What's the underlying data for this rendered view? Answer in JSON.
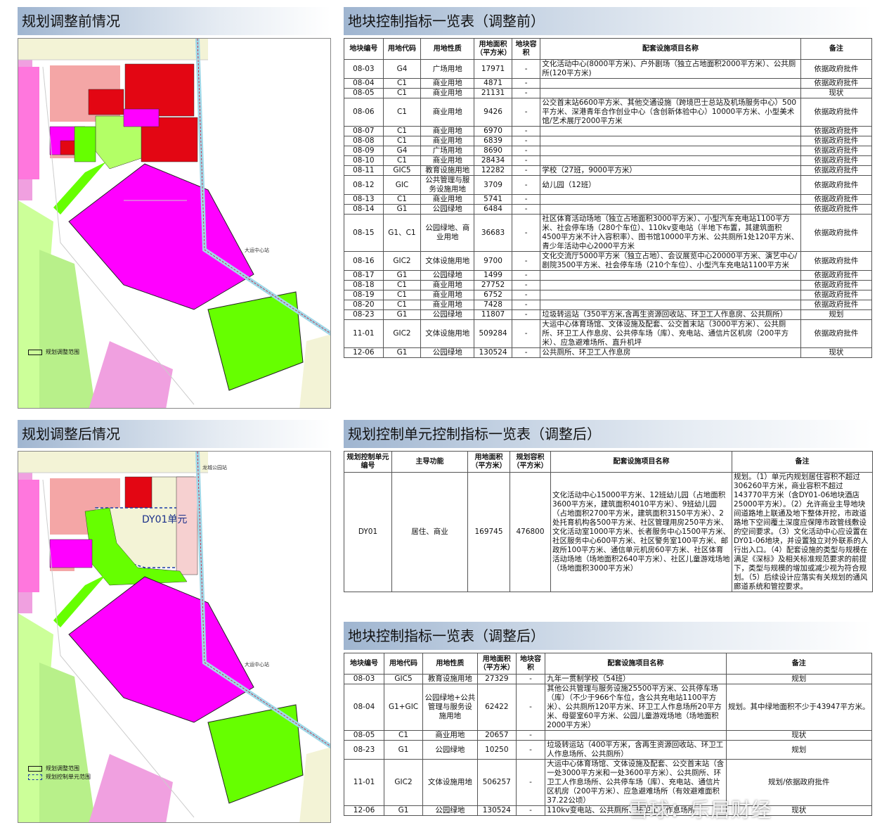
{
  "headers": {
    "before_map": "规划调整前情况",
    "after_map": "规划调整后情况",
    "before_table": "地块控制指标一览表（调整前）",
    "unit_table": "规划控制单元控制指标一览表（调整后）",
    "after_table": "地块控制指标一览表（调整后）"
  },
  "map_before": {
    "labels": {
      "metro": "大运中心站",
      "boundary": "规划调整范围"
    }
  },
  "map_after": {
    "labels": {
      "metro": "大运中心站",
      "park_station": "龙城公园站",
      "dy01": "DY01单元",
      "boundary": "规划调整范围",
      "unit_boundary": "规划控制单元范围"
    }
  },
  "colors": {
    "commercial": "#e30613",
    "public": "#ff00ff",
    "green": "#66ff00",
    "park": "#ccff99",
    "residential": "#f4a6a6",
    "pale": "#f3f3d6",
    "road": "#ffffff"
  },
  "table_before": {
    "columns": [
      "地块编号",
      "用地代码",
      "用地性质",
      "用地面积（平方米）",
      "地块容积",
      "配套设施项目名称",
      "备注"
    ],
    "rows": [
      [
        "08-03",
        "G4",
        "广场用地",
        "17971",
        "-",
        "文化活动中心(8000平方米)、户外剧场（独立占地面积2000平方米）、公共厕所(120平方米)",
        "依据政府批件"
      ],
      [
        "08-04",
        "C1",
        "商业用地",
        "4871",
        "-",
        "",
        "依据政府批件"
      ],
      [
        "08-05",
        "C1",
        "商业用地",
        "21131",
        "-",
        "",
        "现状"
      ],
      [
        "08-06",
        "C1",
        "商业用地",
        "9426",
        "-",
        "公交首末站6600平方米、其他交通设施（跨境巴士总站及机场服务中心）500平方米、深港青年合作创业中心（含创新体验中心）10000平方米、小型美术馆/艺术展厅2000平方米",
        "依据政府批件"
      ],
      [
        "08-07",
        "C1",
        "商业用地",
        "6970",
        "-",
        "",
        "依据政府批件"
      ],
      [
        "08-08",
        "C1",
        "商业用地",
        "6839",
        "-",
        "",
        "依据政府批件"
      ],
      [
        "08-09",
        "G4",
        "广场用地",
        "8690",
        "-",
        "",
        "依据政府批件"
      ],
      [
        "08-10",
        "C1",
        "商业用地",
        "28434",
        "-",
        "",
        "依据政府批件"
      ],
      [
        "08-11",
        "GIC5",
        "教育设施用地",
        "12282",
        "-",
        "学校（27班，9000平方米）",
        "依据政府批件"
      ],
      [
        "08-12",
        "GIC",
        "公共管理与服务设施用地",
        "3709",
        "-",
        "幼儿园（12班）",
        "依据政府批件"
      ],
      [
        "08-13",
        "C1",
        "商业用地",
        "5741",
        "-",
        "",
        "依据政府批件"
      ],
      [
        "08-14",
        "G1",
        "公园绿地",
        "6484",
        "-",
        "",
        "依据政府批件"
      ],
      [
        "08-15",
        "G1、C1",
        "公园绿地、商业用地",
        "36683",
        "-",
        "社区体育活动场地（独立占地面积3000平方米）、小型汽车充电站1100平方米、社会停车场（280个车位）、110kv变电站（半地下布置，其建筑面积4500平方米不计入容积率）、图书馆10000平方米、公共厕所1处120平方米、青少年活动中心2000平方米",
        "依据政府批件"
      ],
      [
        "08-16",
        "GIC2",
        "文体设施用地",
        "9700",
        "-",
        "文化交流厅5000平方米（独立占地）、会议展览中心20000平方米、演艺中心/剧院3500平方米、社会停车场（210个车位）、小型汽车充电站1100平方米",
        "依据政府批件"
      ],
      [
        "08-17",
        "G1",
        "公园绿地",
        "1499",
        "-",
        "",
        "依据政府批件"
      ],
      [
        "08-18",
        "C1",
        "商业用地",
        "27752",
        "-",
        "",
        "依据政府批件"
      ],
      [
        "08-19",
        "C1",
        "商业用地",
        "6752",
        "-",
        "",
        "依据政府批件"
      ],
      [
        "08-20",
        "C1",
        "商业用地",
        "7428",
        "-",
        "",
        "依据政府批件"
      ],
      [
        "08-23",
        "G1",
        "公园绿地",
        "11807",
        "-",
        "垃圾转运站（350平方米,含再生资源回收站、环卫工人作息房、公共厕所）",
        "规划"
      ],
      [
        "11-01",
        "GIC2",
        "文体设施用地",
        "509284",
        "-",
        "大运中心体育场馆、文体设施及配套、公交首末站（3000平方米）、公共厕所、环卫工人作息房、公共停车场（库）、充电站、通信片区机房（200平方米）、应急避难场所、直升机坪",
        "依据政府批件"
      ],
      [
        "12-06",
        "G1",
        "公园绿地",
        "130524",
        "-",
        "公共厕所、环卫工人作息房",
        "现状"
      ]
    ]
  },
  "table_unit": {
    "columns": [
      "规划控制单元编号",
      "主导功能",
      "用地面积（平方米）",
      "规划容积（平方米）",
      "配套设施项目名称",
      "备注"
    ],
    "rows": [
      [
        "DY01",
        "居住、商业",
        "169745",
        "476800",
        "文化活动中心15000平方米、12班幼儿园（占地面积3600平方米，建筑面积4010平方米）、9班幼儿园（占地面积2700平方米，建筑面积3150平方米）、2处托育机构各500平方米、社区管理用房250平方米、文化活动室1000平方米、长者服务中心1500平方米、社区服务中心600平方米、社区警务室100平方米、邮政所100平方米、通信单元机房60平方米、社区体育活动场地（场地面积2640平方米）、社区儿童游戏场地（场地面积3000平方米）",
        "规划。（1）单元内规划居住容积不超过306260平方米，商业容积不超过143770平方米（含DY01-06地块酒店25000平方米）。（2）允许商业主导地块间道路地上联通及地下整体开挖，市政道路地下空间覆土深度应保障市政管线敷设的空间要求。（3）文化活动中心应设置在DY01-06地块，并设置独立对外联系的人行出入口。（4）配套设施的类型与规模在满足《深标》及相关标准规范要求的前提下，类型与规模的增加或减少视为符合规划。（5）后续设计应落实有关规划的通风廊道系统和管控要求。"
      ]
    ]
  },
  "table_after": {
    "columns": [
      "地块编号",
      "用地代码",
      "用地性质",
      "用地面积（平方米）",
      "地块容积",
      "配套设施项目名称",
      "备注"
    ],
    "rows": [
      [
        "08-03",
        "GIC5",
        "教育设施用地",
        "27329",
        "-",
        "九年一贯制学校（54班）",
        "规划"
      ],
      [
        "08-04",
        "G1+GIC",
        "公园绿地+公共管理与服务设施用地",
        "62422",
        "-",
        "其他公共管理与服务设施25500平方米、公共停车场（库）（不少于966个车位，含公共充电站1100平方米）、公共厕所120平方米、环卫工人作息场所20平方米、母婴室60平方米、公园儿童游戏场地（场地面积2000平方米）",
        "规划。其中绿地面积不少于43947平方米。"
      ],
      [
        "08-05",
        "C1",
        "商业用地",
        "20657",
        "-",
        "",
        "现状"
      ],
      [
        "08-23",
        "G1",
        "公园绿地",
        "10250",
        "-",
        "垃圾转运站（400平方米，含再生资源回收站、环卫工人作息场所、公共厕所）",
        "规划"
      ],
      [
        "11-01",
        "GIC2",
        "文体设施用地",
        "506257",
        "-",
        "大运中心体育场馆、文体设施及配套、公交首末站（含一处3000平方米和一处3600平方米）、公共厕所、环卫工人作息场所、公共停车场（库）、充电站、通信片区机房（200平方米）、应急避难场所（有效避难面积37.22公顷）",
        "规划/依据政府批件"
      ],
      [
        "12-06",
        "G1",
        "公园绿地",
        "130524",
        "-",
        "110kv变电站、公共厕所、环卫工人作息场所",
        "现状"
      ]
    ]
  },
  "watermark": "雪球：乐居财经"
}
